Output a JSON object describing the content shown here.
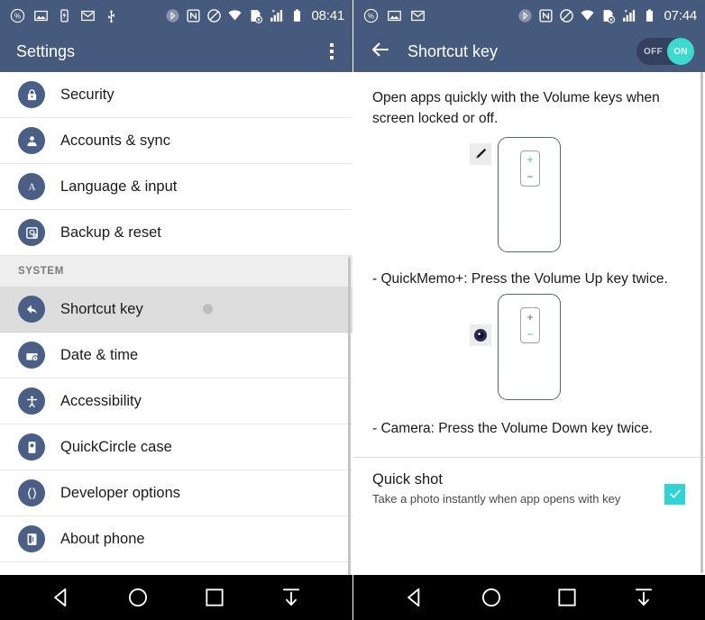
{
  "left_phone": {
    "status_bar": {
      "icons": [
        "percent-circle-icon",
        "image-icon",
        "battery-saver-icon",
        "gmail-icon",
        "usb-icon"
      ],
      "right_icons": [
        "bluetooth-icon",
        "nfc-icon",
        "do-not-disturb-icon",
        "wifi-icon",
        "sd-card-error-icon",
        "signal-bars-icon",
        "battery-icon"
      ],
      "clock": "08:41"
    },
    "appbar": {
      "title": "Settings",
      "overflow_label": "More options"
    },
    "list": [
      {
        "label": "Security",
        "icon": "lock-icon"
      },
      {
        "label": "Accounts & sync",
        "icon": "account-icon"
      },
      {
        "label": "Language & input",
        "icon": "language-icon"
      },
      {
        "label": "Backup & reset",
        "icon": "backup-icon"
      }
    ],
    "section_header": "SYSTEM",
    "system_list": [
      {
        "label": "Shortcut key",
        "icon": "shortcut-key-icon",
        "selected": true
      },
      {
        "label": "Date & time",
        "icon": "clock-calendar-icon",
        "selected": false
      },
      {
        "label": "Accessibility",
        "icon": "accessibility-icon",
        "selected": false
      },
      {
        "label": "QuickCircle case",
        "icon": "quickcircle-icon",
        "selected": false
      },
      {
        "label": "Developer options",
        "icon": "braces-icon",
        "selected": false
      },
      {
        "label": "About phone",
        "icon": "phone-info-icon",
        "selected": false
      }
    ]
  },
  "right_phone": {
    "status_bar": {
      "icons": [
        "percent-circle-icon",
        "image-icon",
        "gmail-icon"
      ],
      "right_icons": [
        "bluetooth-icon",
        "nfc-icon",
        "do-not-disturb-icon",
        "wifi-icon",
        "sd-card-error-icon",
        "signal-bars-icon",
        "battery-icon"
      ],
      "clock": "07:44"
    },
    "appbar": {
      "title": "Shortcut key",
      "back_icon": "back-arrow-icon"
    },
    "toggle": {
      "off_label": "OFF",
      "on_label": "ON",
      "state": "ON",
      "on_color": "#3bdbd0",
      "track_color": "#33415e"
    },
    "intro_text": "Open apps quickly with the Volume keys when screen locked or off.",
    "diagrams": [
      {
        "app_icon": "pen-quickmemo-icon",
        "key_up": "+",
        "key_down": "−",
        "highlight": "up",
        "caption": "- QuickMemo+: Press the Volume Up key twice."
      },
      {
        "app_icon": "camera-icon",
        "key_up": "+",
        "key_down": "−",
        "highlight": "down",
        "caption": "- Camera: Press the Volume Down key twice."
      }
    ],
    "quick_shot": {
      "title": "Quick shot",
      "subtitle": "Take a photo instantly when app opens with key",
      "checked": true,
      "check_color": "#2fd4d4"
    }
  },
  "nav_bar": {
    "buttons": [
      {
        "name": "back-button",
        "icon": "triangle-left-icon"
      },
      {
        "name": "home-button",
        "icon": "circle-icon"
      },
      {
        "name": "recents-button",
        "icon": "square-icon"
      },
      {
        "name": "hide-navbar-button",
        "icon": "down-arrow-icon"
      }
    ]
  },
  "theme": {
    "header_color": "#455a7d",
    "accent_color": "#2fd4d4",
    "selected_row_color": "#dddddd"
  }
}
